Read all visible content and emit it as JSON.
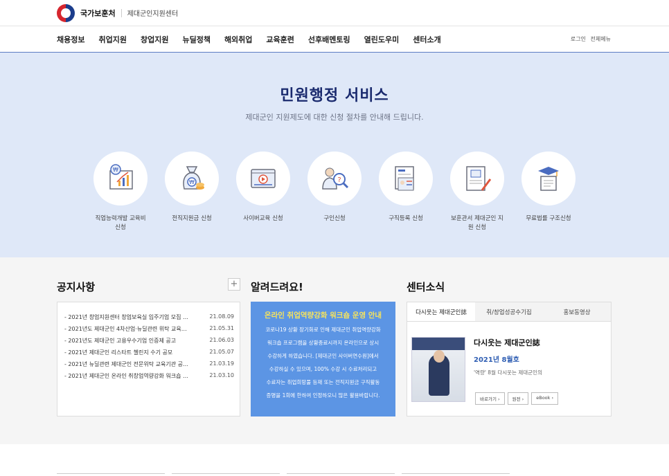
{
  "header": {
    "org": "국가보훈처",
    "sub": "제대군인지원센터"
  },
  "gnb": {
    "items": [
      "채용정보",
      "취업지원",
      "창업지원",
      "뉴딜정책",
      "해외취업",
      "교육훈련",
      "선후배멘토링",
      "열린도우미",
      "센터소개"
    ],
    "util": {
      "login": "로그인",
      "allmenu": "전체메뉴"
    }
  },
  "hero": {
    "title": "민원행정 서비스",
    "subtitle": "제대군인 지원제도에 대한 신청 절차를 안내해 드립니다.",
    "services": [
      {
        "label": "직업능력개발 교육비신청",
        "icon": "chart-money-icon"
      },
      {
        "label": "전직지원금 신청",
        "icon": "money-bag-icon"
      },
      {
        "label": "사이버교육 신청",
        "icon": "video-player-icon"
      },
      {
        "label": "구인신청",
        "icon": "job-search-icon"
      },
      {
        "label": "구직등록 신청",
        "icon": "resume-icon"
      },
      {
        "label": "보훈관서 제대군인 지원 신청",
        "icon": "document-pen-icon"
      },
      {
        "label": "무료법률 구조신청",
        "icon": "graduation-scroll-icon"
      }
    ]
  },
  "notice": {
    "title": "공지사항",
    "more": "+",
    "items": [
      {
        "title": "- 2021년 창업지원센터 창업보육실 입주기업 모집 …",
        "date": "21.08.09"
      },
      {
        "title": "- 2021년도 제대군인 4차산업·뉴딜관련 위탁 교육…",
        "date": "21.05.31"
      },
      {
        "title": "- 2021년도 제대군인 고용우수기업 인증제 공고",
        "date": "21.06.03"
      },
      {
        "title": "- 2021년 제대군인 리스타트 첼린지 수기 공모",
        "date": "21.05.07"
      },
      {
        "title": "- 2021년 뉴딜관련 제대군인 전문위탁 교육기관 공…",
        "date": "21.03.19"
      },
      {
        "title": "- 2021년 제대군인 온라인 취창업역량강화 워크숍 …",
        "date": "21.03.10"
      }
    ]
  },
  "alert": {
    "title": "알려드려요!",
    "banner_title": "온라인 취업역량강화 워크숍 운영 안내",
    "banner_lines": [
      "코로나19 상황 장기화로 인해 제대군인 취업역량강화",
      "워크숍 프로그램을 상황종료시까지 온라인으로 상시",
      "수강하게 하였습니다. [제대군인 사이버연수원]에서",
      "수강하실 수 있으며, 100% 수강 시 수료처리되고",
      "수료자는 취업희망풀 등재 또는 전직지원금 구직활동",
      "증명을 1회에 한하여 인정하오니 많은 활용바랍니다."
    ]
  },
  "center": {
    "title": "센터소식",
    "tabs": [
      "다시웃는 제대군인誌",
      "취/창업성공수기집",
      "홍보동영상"
    ],
    "mag_title": "다시웃는 제대군인誌",
    "issue": "2021년 8월호",
    "desc": "'역량' 8월 다시웃는 제대군인의",
    "buttons": [
      "바로가기 ›",
      "원전 ›",
      "eBook ›"
    ]
  }
}
